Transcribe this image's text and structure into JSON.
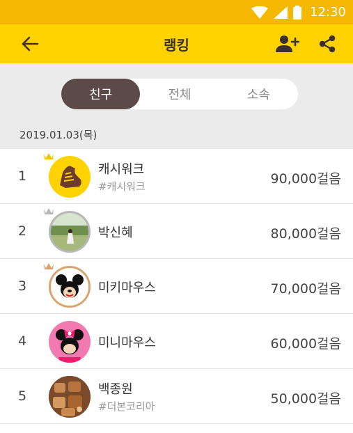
{
  "status": {
    "time": "12:30"
  },
  "appbar": {
    "title": "랭킹",
    "back_icon": "arrow-left-icon",
    "add_friend_icon": "person-add-icon",
    "share_icon": "share-icon"
  },
  "tabs": {
    "items": [
      {
        "label": "친구",
        "active": true
      },
      {
        "label": "전체",
        "active": false
      },
      {
        "label": "소속",
        "active": false
      }
    ]
  },
  "date": "2019.01.03(목)",
  "rankings": [
    {
      "rank": "1",
      "name": "캐시워크",
      "sub": "#캐시워크",
      "steps": "90,000걸음",
      "crown": "gold"
    },
    {
      "rank": "2",
      "name": "박신혜",
      "sub": "",
      "steps": "80,000걸음",
      "crown": "silver"
    },
    {
      "rank": "3",
      "name": "미키마우스",
      "sub": "",
      "steps": "70,000걸음",
      "crown": "bronze"
    },
    {
      "rank": "4",
      "name": "미니마우스",
      "sub": "",
      "steps": "60,000걸음",
      "crown": ""
    },
    {
      "rank": "5",
      "name": "백종원",
      "sub": "#더본코리아",
      "steps": "50,000걸음",
      "crown": ""
    }
  ],
  "colors": {
    "status_bar": "#f4b800",
    "app_bar": "#ffd200",
    "active_tab": "#5b4a48",
    "gold": "#f5c400",
    "silver": "#b8b8b8",
    "bronze": "#d8a56e"
  }
}
